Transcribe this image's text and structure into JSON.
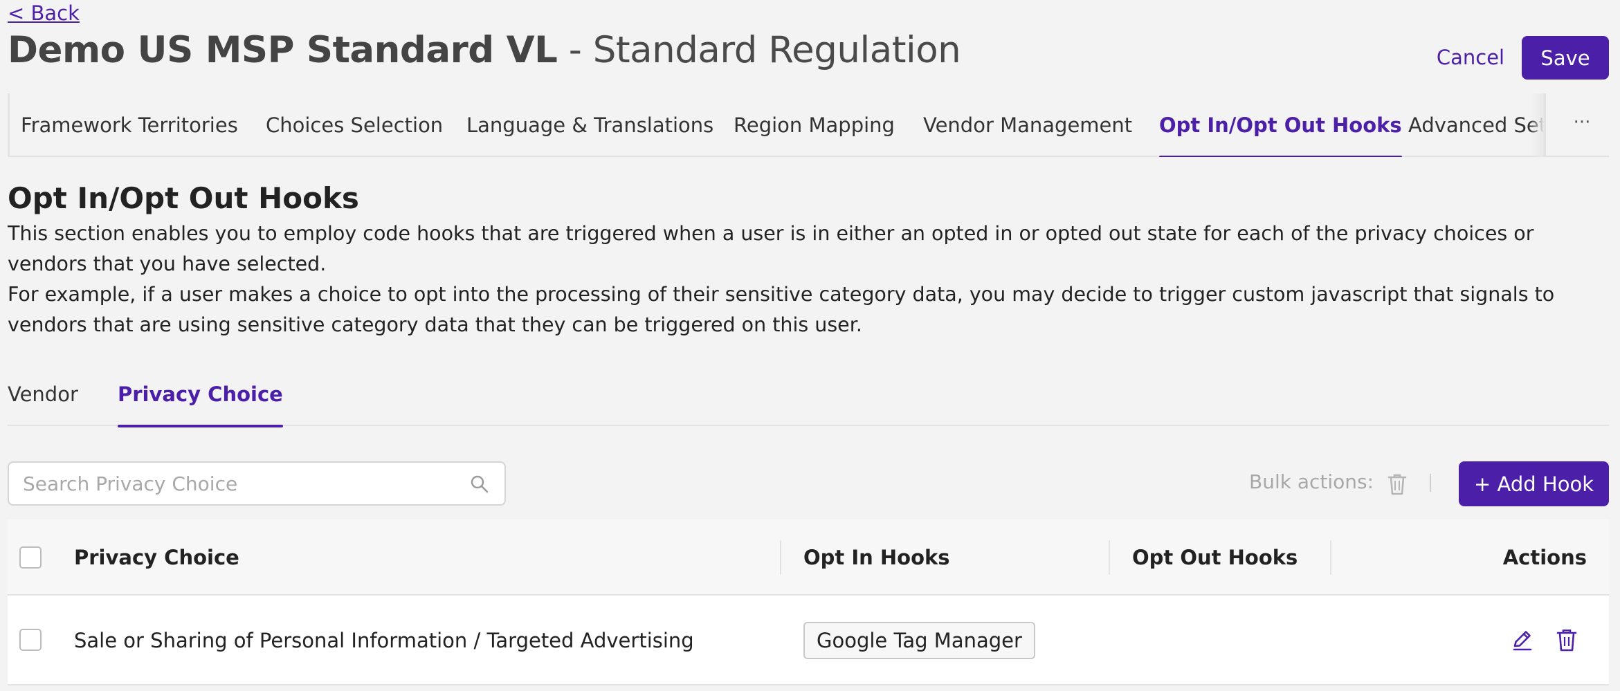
{
  "header": {
    "back_label": "< Back",
    "title_bold": "Demo US MSP Standard VL",
    "title_rest": " - Standard Regulation",
    "cancel_label": "Cancel",
    "save_label": "Save"
  },
  "tabs": [
    {
      "label": "Framework Territories"
    },
    {
      "label": "Choices Selection"
    },
    {
      "label": "Language & Translations"
    },
    {
      "label": "Region Mapping"
    },
    {
      "label": "Vendor Management"
    },
    {
      "label": "Opt In/Opt Out Hooks",
      "active": true
    },
    {
      "label": "Advanced Settings"
    }
  ],
  "tabs_more": "···",
  "section": {
    "title": "Opt In/Opt Out Hooks",
    "desc_1": "This section enables you to employ code hooks that are triggered when a user is in either an opted in or opted out state for each of the privacy choices or vendors that you have selected.",
    "desc_2": "For example, if a user makes a choice to opt into the processing of their sensitive category data, you may decide to trigger custom javascript that signals to vendors that are using sensitive category data that they can be triggered on this user."
  },
  "subtabs": [
    {
      "label": "Vendor"
    },
    {
      "label": "Privacy Choice",
      "active": true
    }
  ],
  "toolbar": {
    "search_placeholder": "Search Privacy Choice",
    "search_value": "",
    "bulk_label": "Bulk actions:",
    "add_hook_label": "+ Add Hook"
  },
  "table": {
    "columns": [
      "Privacy Choice",
      "Opt In Hooks",
      "Opt Out Hooks",
      "Actions"
    ],
    "rows": [
      {
        "privacy_choice": "Sale or Sharing of Personal Information / Targeted Advertising",
        "opt_in_hooks": [
          "Google Tag Manager"
        ],
        "opt_out_hooks": [],
        "actions": [
          "pencil-icon",
          "trash-icon"
        ]
      }
    ]
  },
  "colors": {
    "accent": "#4b1fa8",
    "background": "#f3f3f3",
    "placeholder": "#a8a8a8"
  }
}
